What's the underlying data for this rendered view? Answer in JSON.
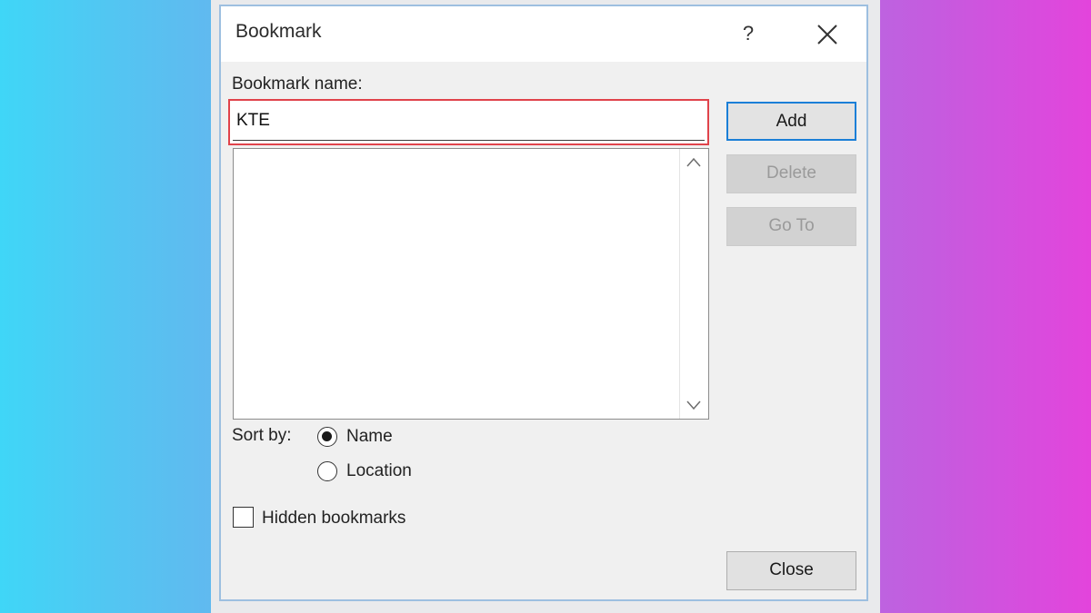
{
  "dialog": {
    "title": "Bookmark",
    "help_label": "?",
    "close_icon": "close-x-icon"
  },
  "form": {
    "name_label": "Bookmark name:",
    "name_value": "KTE",
    "bookmarks": [],
    "scroll_up_icon": "chevron-up-icon",
    "scroll_down_icon": "chevron-down-icon"
  },
  "buttons": {
    "add": "Add",
    "delete": "Delete",
    "goto": "Go To",
    "close": "Close"
  },
  "sort": {
    "label": "Sort by:",
    "options": [
      {
        "label": "Name",
        "selected": true
      },
      {
        "label": "Location",
        "selected": false
      }
    ]
  },
  "hidden": {
    "label": "Hidden bookmarks",
    "checked": false
  },
  "colors": {
    "highlight_border": "#e0434b",
    "default_button_border": "#1b7fd7",
    "dialog_border": "#9dbfe0"
  }
}
